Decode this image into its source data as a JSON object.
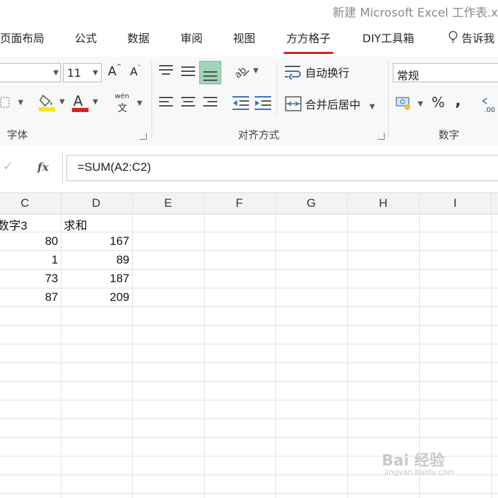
{
  "window": {
    "title": "新建 Microsoft Excel 工作表.x"
  },
  "tabs": [
    {
      "label": "页面布局"
    },
    {
      "label": "公式"
    },
    {
      "label": "数据"
    },
    {
      "label": "审阅"
    },
    {
      "label": "视图"
    },
    {
      "label": "方方格子",
      "active": true
    },
    {
      "label": "DIY工具箱"
    },
    {
      "label": "告诉我"
    }
  ],
  "ribbon": {
    "font": {
      "size": "11",
      "grow_label": "A",
      "shrink_label": "A",
      "font_color_label": "A",
      "phonetic_label": "wén",
      "phonetic_char": "文",
      "group_label": "字体"
    },
    "alignment": {
      "wrap_label": "自动换行",
      "merge_label": "合并后居中",
      "group_label": "对齐方式"
    },
    "number": {
      "format": "常规",
      "percent": "%",
      "comma": ",",
      "group_label": "数字"
    }
  },
  "formula_bar": {
    "cancel": "✓",
    "fx": "fx",
    "formula": "=SUM(A2:C2)"
  },
  "grid": {
    "columns": [
      "C",
      "D",
      "E",
      "F",
      "G",
      "H",
      "I"
    ],
    "rows": [
      [
        "数字3",
        "求和"
      ],
      [
        "80",
        "167"
      ],
      [
        "1",
        "89"
      ],
      [
        "73",
        "187"
      ],
      [
        "87",
        "209"
      ]
    ]
  },
  "watermark": {
    "main": "Bai 经验",
    "sub": "jingyan.baidu.com"
  },
  "colors": {
    "accent_underline": "#d42020",
    "selected_button": "#9fd5b7",
    "font_color_bar": "#e02020",
    "fill_color_bar": "#f5e800"
  }
}
